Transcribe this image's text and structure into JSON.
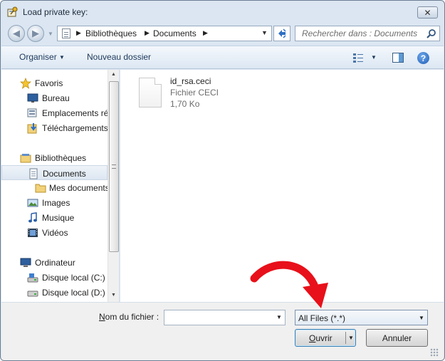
{
  "window": {
    "title": "Load private key:",
    "close_glyph": "✕"
  },
  "address": {
    "crumbs": [
      "Bibliothèques",
      "Documents"
    ],
    "search_placeholder": "Rechercher dans : Documents"
  },
  "toolbar": {
    "organize_label": "Organiser",
    "new_folder_label": "Nouveau dossier",
    "help_glyph": "?"
  },
  "nav": {
    "favorites_label": "Favoris",
    "favorites": [
      "Bureau",
      "Emplacements récents",
      "Téléchargements"
    ],
    "libraries_label": "Bibliothèques",
    "libraries": [
      "Documents",
      "Mes documents",
      "Images",
      "Musique",
      "Vidéos"
    ],
    "computer_label": "Ordinateur",
    "drives": [
      "Disque local (C:)",
      "Disque local (D:)"
    ],
    "selected": "Documents"
  },
  "file": {
    "name": "id_rsa.ceci",
    "type": "Fichier CECI",
    "size": "1,70 Ko"
  },
  "bottom": {
    "filename_label_accel": "N",
    "filename_label_rest": "om du fichier :",
    "filename_value": "",
    "filter_value": "All Files (*.*)",
    "open_accel": "O",
    "open_rest": "uvrir",
    "cancel_label": "Annuler"
  },
  "colors": {
    "annotation_arrow": "#e8101a",
    "accent": "#1f5eb6"
  },
  "icons": [
    "app-key-icon",
    "back-arrow-icon",
    "forward-arrow-icon",
    "document-icon",
    "refresh-icon",
    "search-icon",
    "views-icon",
    "preview-pane-icon",
    "help-icon",
    "star-icon",
    "desktop-icon",
    "recent-places-icon",
    "downloads-icon",
    "library-icon",
    "folder-icon",
    "images-icon",
    "music-icon",
    "video-icon",
    "computer-icon",
    "drive-c-icon",
    "drive-d-icon",
    "file-icon"
  ]
}
